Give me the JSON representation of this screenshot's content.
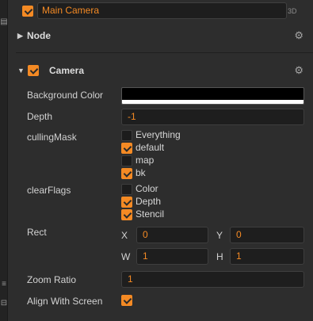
{
  "node": {
    "name": "Main Camera",
    "active": true,
    "tag_3d": "3D"
  },
  "sections": {
    "node": {
      "title": "Node",
      "expanded": false,
      "arrow_icon": "triangle-right-icon",
      "gear_icon": "gear-icon"
    },
    "camera": {
      "title": "Camera",
      "expanded": true,
      "enabled": true,
      "arrow_icon": "triangle-down-icon",
      "gear_icon": "gear-icon"
    }
  },
  "properties": {
    "background_color": {
      "label": "Background Color",
      "color": "#000000",
      "alpha_color": "#ffffff"
    },
    "depth": {
      "label": "Depth",
      "value": "-1"
    },
    "culling_mask": {
      "label": "cullingMask",
      "options": [
        {
          "label": "Everything",
          "checked": false
        },
        {
          "label": "default",
          "checked": true
        },
        {
          "label": "map",
          "checked": false
        },
        {
          "label": "bk",
          "checked": true
        }
      ]
    },
    "clear_flags": {
      "label": "clearFlags",
      "options": [
        {
          "label": "Color",
          "checked": false
        },
        {
          "label": "Depth",
          "checked": true
        },
        {
          "label": "Stencil",
          "checked": true
        }
      ]
    },
    "rect": {
      "label": "Rect",
      "x_label": "X",
      "x": "0",
      "y_label": "Y",
      "y": "0",
      "w_label": "W",
      "w": "1",
      "h_label": "H",
      "h": "1"
    },
    "zoom_ratio": {
      "label": "Zoom Ratio",
      "value": "1"
    },
    "align_with_screen": {
      "label": "Align With Screen",
      "checked": true
    }
  },
  "left_strip_glyphs": [
    "▤",
    "≡",
    "⊟"
  ],
  "accent_color": "#f48a24"
}
